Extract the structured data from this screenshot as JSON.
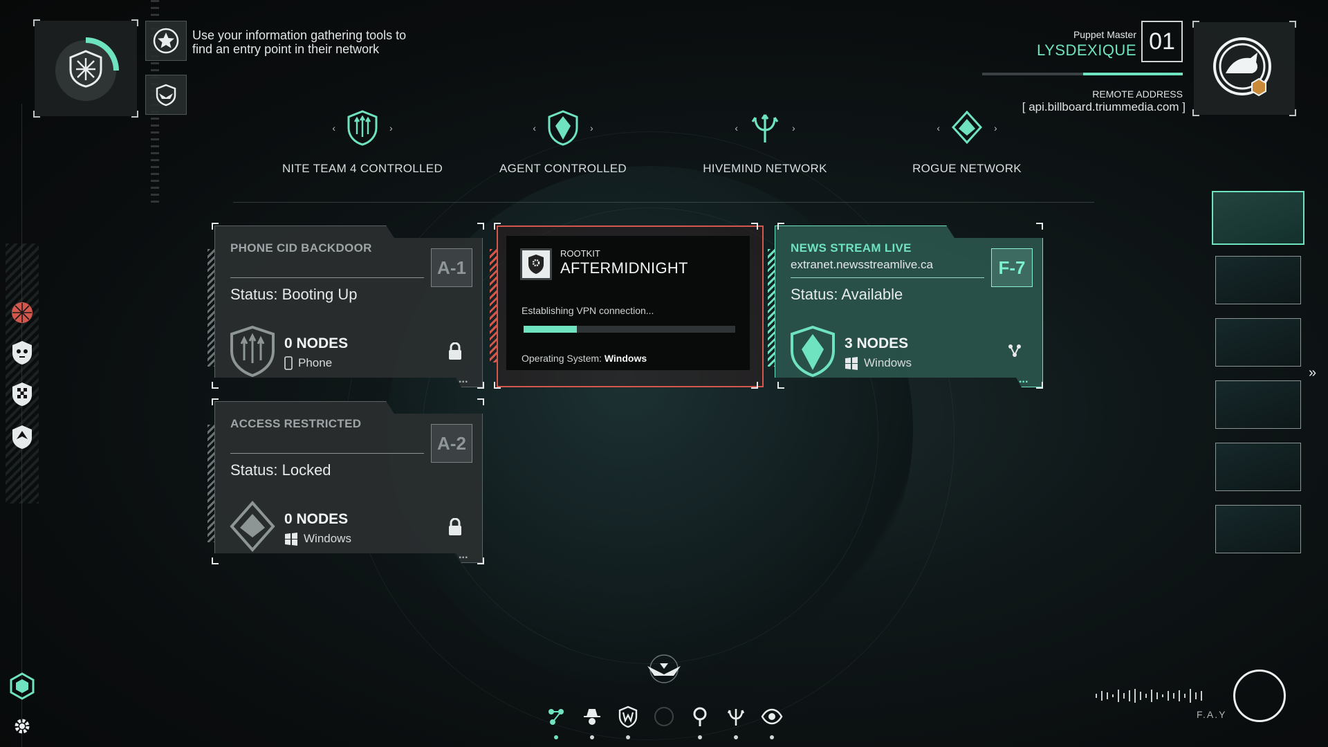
{
  "objective": {
    "line1": "Use your information gathering tools to",
    "line2": "find an entry point in their network"
  },
  "player": {
    "role_label": "Puppet Master",
    "name": "LYSDEXIQUE",
    "number": "01",
    "remote_label": "REMOTE ADDRESS",
    "remote_address": "[ api.billboard.triummedia.com ]"
  },
  "filters": [
    {
      "label": "NITE TEAM 4 CONTROLLED",
      "icon": "trident-shield-icon"
    },
    {
      "label": "AGENT CONTROLLED",
      "icon": "agent-shield-icon"
    },
    {
      "label": "HIVEMIND NETWORK",
      "icon": "trident-icon"
    },
    {
      "label": "ROGUE NETWORK",
      "icon": "rogue-diamond-icon"
    }
  ],
  "cards": {
    "a1": {
      "title": "PHONE CID BACKDOOR",
      "code": "A-1",
      "status": "Status: Booting Up",
      "nodes": "0 NODES",
      "os": "Phone",
      "dots": "▪▪▪▪▪"
    },
    "a2": {
      "title": "ACCESS RESTRICTED",
      "code": "A-2",
      "status": "Status: Locked",
      "nodes": "0 NODES",
      "os": "Windows",
      "dots": "▪▪▪▪▪"
    },
    "f7": {
      "title": "NEWS STREAM LIVE",
      "subtitle": "extranet.newsstreamlive.ca",
      "code": "F-7",
      "status": "Status: Available",
      "nodes": "3 NODES",
      "os": "Windows",
      "dots": "▪▪▪▪▪"
    }
  },
  "rootkit": {
    "kicker": "ROOTKIT",
    "title": "AFTERMIDNIGHT",
    "message": "Establishing VPN connection...",
    "progress": 0.25,
    "os_label": "Operating System:",
    "os_value": "Windows"
  },
  "footer": {
    "fay": "F.A.Y"
  },
  "colors": {
    "accent": "#6fe3c0",
    "alert": "#d3574c",
    "panel": "#2a2f30"
  }
}
